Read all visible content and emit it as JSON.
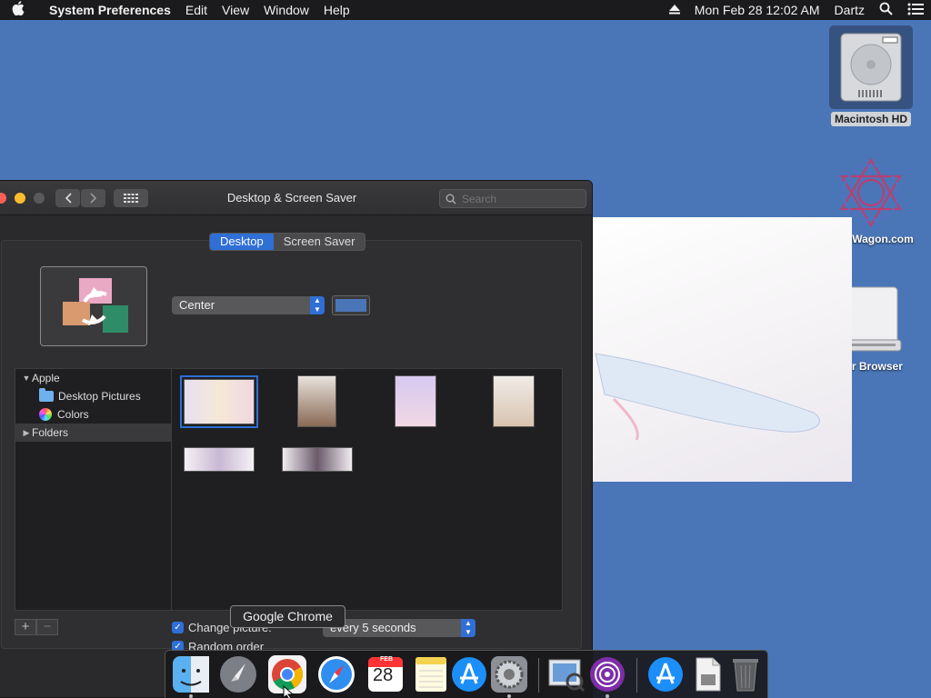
{
  "menubar": {
    "apple": "",
    "app_name": "System Preferences",
    "items": [
      "Edit",
      "View",
      "Window",
      "Help"
    ],
    "clock": "Mon Feb 28  12:02 AM",
    "user": "Dartz"
  },
  "desktop": {
    "icons": [
      {
        "label": "Macintosh HD",
        "icon": "hard-drive-icon"
      },
      {
        "label": "DataWagon.com",
        "icon": "network-logo-icon"
      },
      {
        "label": "Tor Browser",
        "icon": "disk-image-icon"
      }
    ]
  },
  "window": {
    "title": "Desktop & Screen Saver",
    "search_placeholder": "Search",
    "tabs": [
      {
        "label": "Desktop",
        "active": true
      },
      {
        "label": "Screen Saver",
        "active": false
      }
    ],
    "fit_option": "Center",
    "background_color": "#4a76b8",
    "sidebar": {
      "apple_group": "Apple",
      "desktop_pictures": "Desktop Pictures",
      "colors": "Colors",
      "folders": "Folders"
    },
    "add_label": "+",
    "remove_label": "−",
    "change_picture_label": "Change picture:",
    "interval": "every 5 seconds",
    "random_label": "Random order"
  },
  "tooltip": "Google Chrome",
  "dock": {
    "apps": [
      "Finder",
      "Launchpad",
      "Google Chrome",
      "Safari",
      "Calendar",
      "Notes",
      "App Store",
      "System Preferences",
      "Preview",
      "Tor",
      "App Store Downloads",
      "Document",
      "Trash"
    ],
    "calendar_month": "FEB",
    "calendar_day": "28"
  },
  "colors": {
    "desktop": "#4a76b8",
    "accent": "#2f6fd6"
  }
}
